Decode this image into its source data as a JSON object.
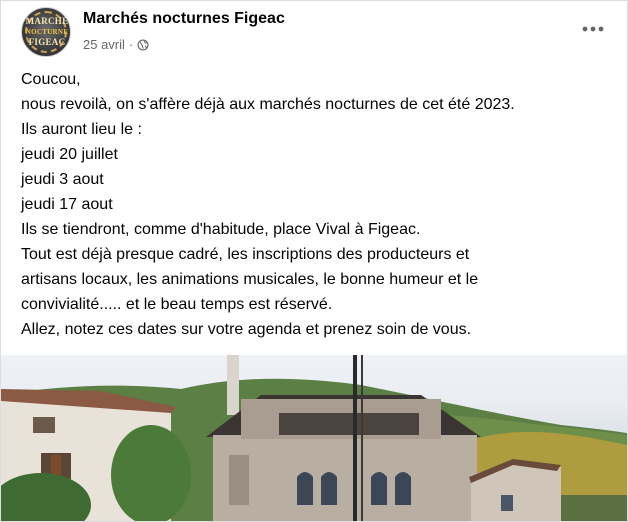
{
  "post": {
    "page_name": "Marchés nocturnes Figeac",
    "date": "25 avril",
    "separator": "·",
    "visibility_icon": "globe-icon",
    "more_icon": "more-horizontal-icon",
    "avatar": {
      "line1": "MARCHE",
      "line2": "NOCTURNE",
      "line3": "FIGEAC"
    },
    "text_lines": [
      "Coucou,",
      "nous revoilà, on s'affère déjà aux marchés nocturnes de cet été 2023.",
      "Ils auront lieu le :",
      "jeudi 20 juillet",
      "jeudi 3 aout",
      "jeudi 17 aout",
      "Ils se tiendront, comme d'habitude, place Vival à Figeac.",
      "Tout est déjà presque cadré, les inscriptions des producteurs et",
      "artisans locaux, les animations musicales, le bonne humeur et le",
      "convivialité..... et le beau temps est réservé.",
      "Allez, notez ces dates sur votre agenda et prenez soin de vous."
    ]
  },
  "colors": {
    "primary_text": "#050505",
    "secondary_text": "#65676b",
    "card_bg": "#ffffff",
    "border": "#dadde1"
  }
}
